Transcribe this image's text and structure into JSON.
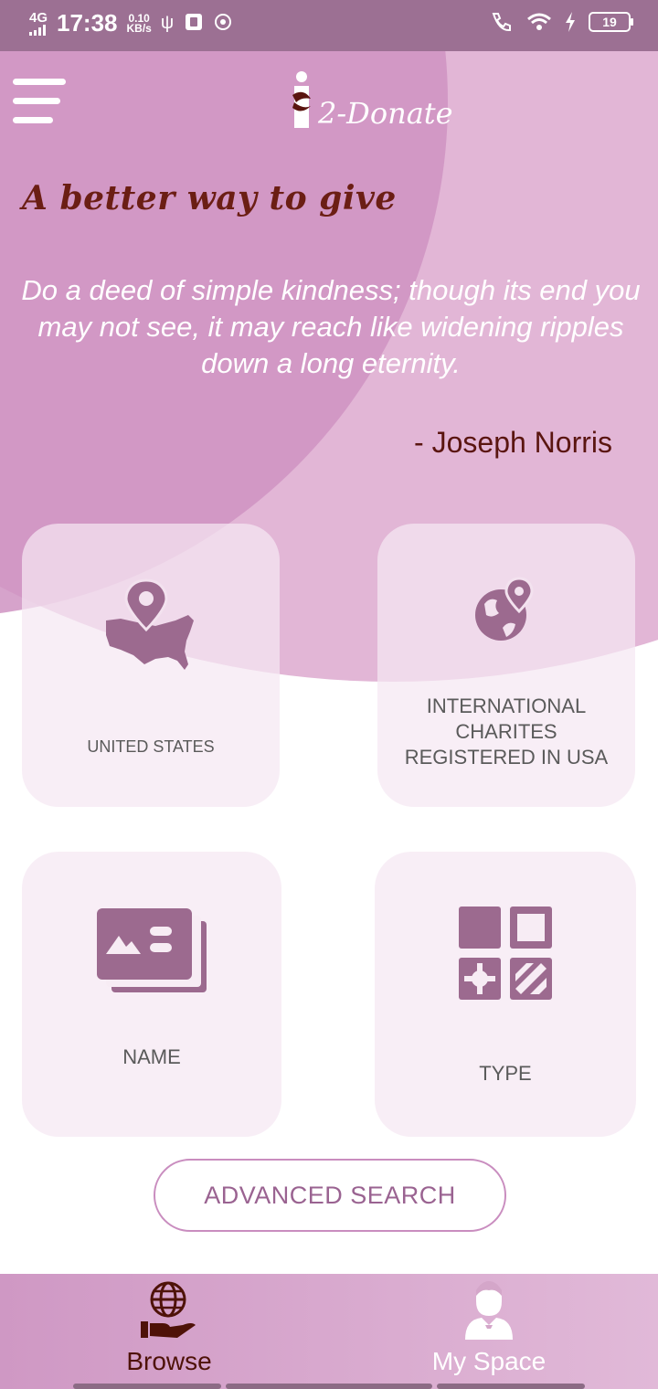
{
  "status_bar": {
    "network": "4G",
    "time": "17:38",
    "speed_value": "0.10",
    "speed_unit": "KB/s",
    "battery": "19"
  },
  "header": {
    "logo_text": "2-Donate"
  },
  "hero": {
    "tagline": "A better way to give",
    "quote": "Do a deed of simple kindness; though its end you may not see, it may reach like widening ripples down a long eternity.",
    "author": "- Joseph Norris"
  },
  "cards": {
    "united_states": {
      "label": "UNITED STATES",
      "icon": "usa-map-pin-icon"
    },
    "international": {
      "label": "INTERNATIONAL CHARITES REGISTERED IN USA",
      "icon": "globe-pin-icon"
    },
    "name": {
      "label": "NAME",
      "icon": "name-card-icon"
    },
    "type": {
      "label": "TYPE",
      "icon": "category-grid-icon"
    }
  },
  "advanced_search": {
    "label": "ADVANCED SEARCH"
  },
  "bottom_nav": {
    "browse": {
      "label": "Browse",
      "icon": "globe-hand-icon"
    },
    "my_space": {
      "label": "My Space",
      "icon": "user-avatar-icon"
    }
  },
  "colors": {
    "accent": "#9c7093",
    "hero_dark": "#cf93c2",
    "hero_light": "#e2b6d6",
    "tagline": "#6b1e14",
    "icon": "#9c6a8f"
  }
}
